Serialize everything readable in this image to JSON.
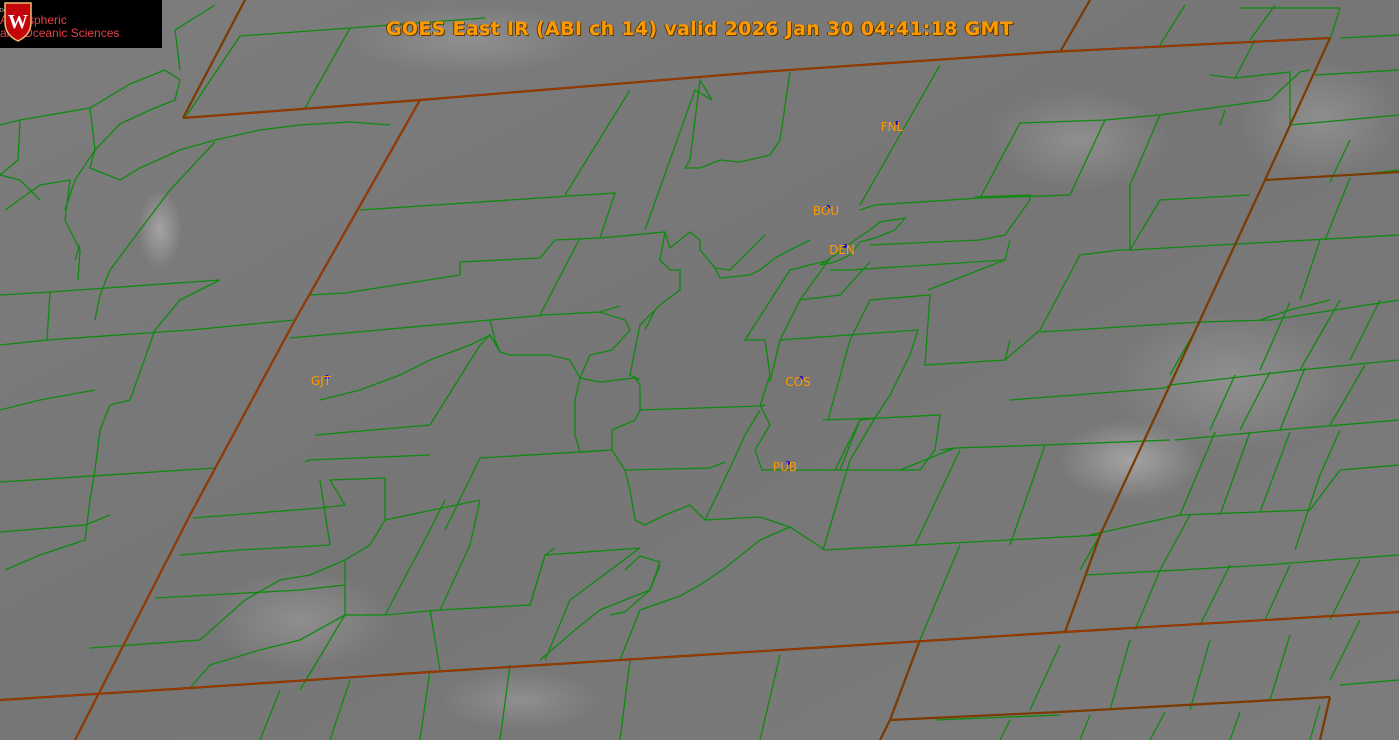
{
  "title": "GOES East IR (ABI ch 14) valid 2026 Jan 30 04:41:18 GMT",
  "logo": {
    "department": "Department of",
    "line1": "Atmospheric",
    "line2": "and Oceanic Sciences",
    "crest_letter": "W"
  },
  "stations": [
    {
      "id": "FNL"
    },
    {
      "id": "BOU"
    },
    {
      "id": "DEN"
    },
    {
      "id": "GJT"
    },
    {
      "id": "COS"
    },
    {
      "id": "PUB"
    }
  ],
  "colors": {
    "title": "#ff9900",
    "station_label": "#ff9900",
    "station_marker": "#1010cc",
    "county_border": "#0e8a0e",
    "state_border": "#7a3a00",
    "background_ir": "#7a7a7a"
  }
}
